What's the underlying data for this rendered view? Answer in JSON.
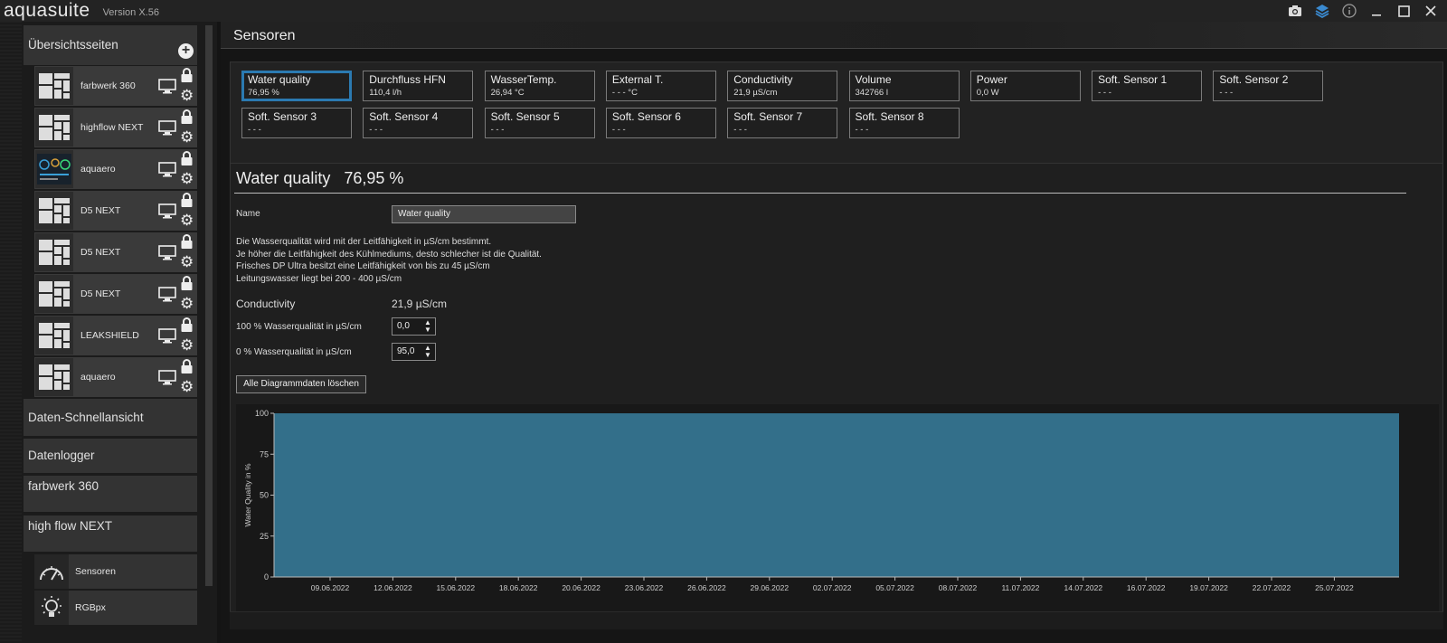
{
  "app": {
    "logo": "aquasuite",
    "version": "Version X.56"
  },
  "sidebar": {
    "overview_title": "Übersichtsseiten",
    "tiles": [
      {
        "label": "farbwerk 360",
        "thumb": "layout"
      },
      {
        "label": "highflow NEXT",
        "thumb": "layout"
      },
      {
        "label": "aquaero",
        "thumb": "dashboard"
      },
      {
        "label": "D5 NEXT",
        "thumb": "layout"
      },
      {
        "label": "D5 NEXT",
        "thumb": "layout"
      },
      {
        "label": "D5 NEXT",
        "thumb": "layout"
      },
      {
        "label": "LEAKSHIELD",
        "thumb": "layout"
      },
      {
        "label": "aquaero",
        "thumb": "layout"
      }
    ],
    "sections": [
      "Daten-Schnellansicht",
      "Datenlogger",
      "farbwerk 360",
      "high flow NEXT"
    ],
    "sub_items": [
      {
        "label": "Sensoren",
        "icon": "gauge-icon"
      },
      {
        "label": "RGBpx",
        "icon": "bulb-icon"
      }
    ]
  },
  "page": {
    "title": "Sensoren"
  },
  "sensors": [
    {
      "name": "Water quality",
      "value": "76,95 %",
      "active": true
    },
    {
      "name": "Durchfluss HFN",
      "value": "110,4 l/h"
    },
    {
      "name": "WasserTemp.",
      "value": "26,94 °C"
    },
    {
      "name": "External T.",
      "value": "- - - °C"
    },
    {
      "name": "Conductivity",
      "value": "21,9 µS/cm"
    },
    {
      "name": "Volume",
      "value": "342766 l"
    },
    {
      "name": "Power",
      "value": "0,0 W"
    },
    {
      "name": "Soft. Sensor 1",
      "value": "- - -"
    },
    {
      "name": "Soft. Sensor 2",
      "value": "- - -"
    },
    {
      "name": "Soft. Sensor 3",
      "value": "- - -"
    },
    {
      "name": "Soft. Sensor 4",
      "value": "- - -"
    },
    {
      "name": "Soft. Sensor 5",
      "value": "- - -"
    },
    {
      "name": "Soft. Sensor 6",
      "value": "- - -"
    },
    {
      "name": "Soft. Sensor 7",
      "value": "- - -"
    },
    {
      "name": "Soft. Sensor 8",
      "value": "- - -"
    }
  ],
  "detail": {
    "title": "Water quality",
    "value": "76,95 %",
    "name_label": "Name",
    "name_value": "Water quality",
    "description": [
      "Die Wasserqualität wird mit der Leitfähigkeit in µS/cm bestimmt.",
      "Je höher die Leitfähigkeit des Kühlmediums, desto schlecher ist die Qualität.",
      "Frisches DP Ultra besitzt eine Leitfähigkeit von bis zu 45 µS/cm",
      "Leitungswasser liegt bei 200 - 400 µS/cm"
    ],
    "conductivity_label": "Conductivity",
    "conductivity_value": "21,9 µS/cm",
    "q100_label": "100 % Wasserqualität in µS/cm",
    "q100_value": "0,0",
    "q0_label": "0 % Wasserqualität in µS/cm",
    "q0_value": "95,0",
    "clear_button": "Alle Diagrammdaten löschen"
  },
  "chart_data": {
    "type": "area",
    "ylabel": "Water Quality in %",
    "xlabel": "",
    "ylim": [
      0,
      100
    ],
    "yticks": [
      0,
      25,
      50,
      75,
      100
    ],
    "x": [
      "09.06.2022",
      "12.06.2022",
      "15.06.2022",
      "18.06.2022",
      "20.06.2022",
      "23.06.2022",
      "26.06.2022",
      "29.06.2022",
      "02.07.2022",
      "05.07.2022",
      "08.07.2022",
      "11.07.2022",
      "14.07.2022",
      "16.07.2022",
      "19.07.2022",
      "22.07.2022",
      "25.07.2022"
    ],
    "series": [
      {
        "values": [
          100,
          100,
          100,
          100,
          100,
          100,
          100,
          100,
          100,
          100,
          100,
          100,
          100,
          100,
          100,
          100,
          100
        ]
      }
    ],
    "fill_color": "#336f8a",
    "grid": false
  },
  "colors": {
    "accent": "#2b7ab1",
    "chart_fill": "#336f8a"
  }
}
